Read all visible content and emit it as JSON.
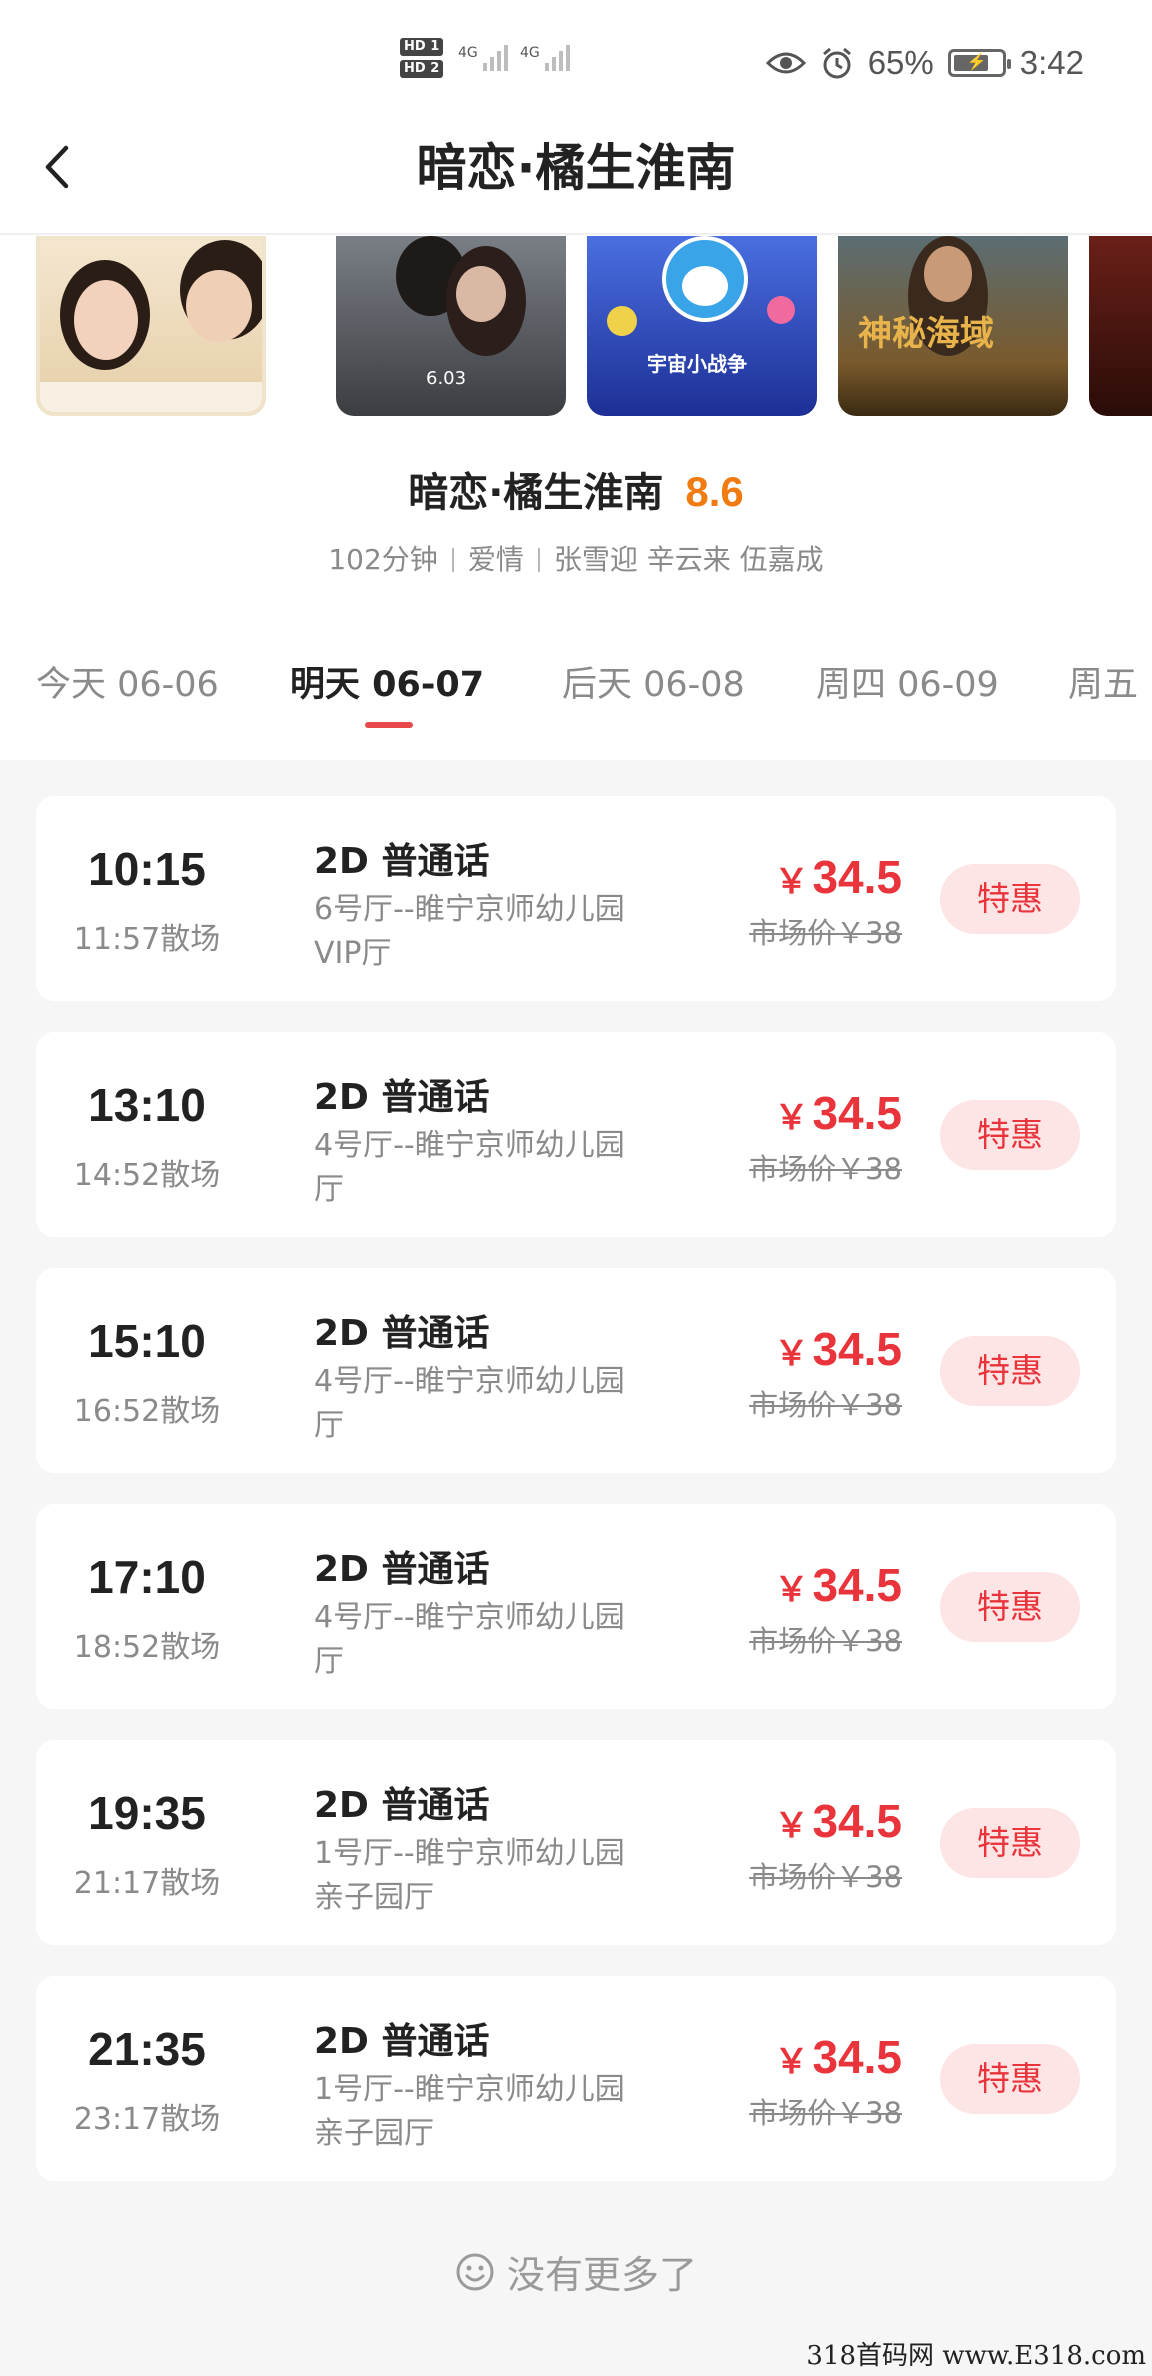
{
  "status_bar": {
    "hd1": "HD 1",
    "hd2": "HD 2",
    "net1": "4G",
    "net2": "4G",
    "battery_percent": "65%",
    "time": "3:42",
    "icons": [
      "eye-icon",
      "alarm-icon",
      "battery-icon"
    ]
  },
  "header": {
    "title": "暗恋·橘生淮南",
    "back_icon": "chevron-left-icon"
  },
  "movie": {
    "title": "暗恋·橘生淮南",
    "score": "8.6",
    "duration": "102分钟",
    "genre": "爱情",
    "cast": "张雪迎 辛云来 伍嘉成"
  },
  "posters": [
    {
      "text": ""
    },
    {
      "text": "6.03"
    },
    {
      "text": "宇宙小战争"
    },
    {
      "text": "神秘海域"
    },
    {
      "text": ""
    }
  ],
  "date_tabs": [
    {
      "label": "今天 06-06"
    },
    {
      "label": "明天 06-07"
    },
    {
      "label": "后天 06-08"
    },
    {
      "label": "周四 06-09"
    },
    {
      "label": "周五"
    }
  ],
  "shows": [
    {
      "start": "10:15",
      "end": "11:57散场",
      "format": "2D 普通话",
      "hall": "6号厅--睢宁京师幼儿园VIP厅",
      "price": "34.5",
      "market": "市场价￥38",
      "badge": "特惠"
    },
    {
      "start": "13:10",
      "end": "14:52散场",
      "format": "2D 普通话",
      "hall": "4号厅--睢宁京师幼儿园厅",
      "price": "34.5",
      "market": "市场价￥38",
      "badge": "特惠"
    },
    {
      "start": "15:10",
      "end": "16:52散场",
      "format": "2D 普通话",
      "hall": "4号厅--睢宁京师幼儿园厅",
      "price": "34.5",
      "market": "市场价￥38",
      "badge": "特惠"
    },
    {
      "start": "17:10",
      "end": "18:52散场",
      "format": "2D 普通话",
      "hall": "4号厅--睢宁京师幼儿园厅",
      "price": "34.5",
      "market": "市场价￥38",
      "badge": "特惠"
    },
    {
      "start": "19:35",
      "end": "21:17散场",
      "format": "2D 普通话",
      "hall": "1号厅--睢宁京师幼儿园亲子园厅",
      "price": "34.5",
      "market": "市场价￥38",
      "badge": "特惠"
    },
    {
      "start": "21:35",
      "end": "23:17散场",
      "format": "2D 普通话",
      "hall": "1号厅--睢宁京师幼儿园亲子园厅",
      "price": "34.5",
      "market": "市场价￥38",
      "badge": "特惠"
    }
  ],
  "price_currency": "￥",
  "footer": {
    "no_more": "没有更多了",
    "icon": "smiley-icon"
  },
  "watermark": "318首码网 www.E318.com",
  "colors": {
    "accent": "#e8343a",
    "score": "#f07b10",
    "badge_bg": "#fde4e5"
  }
}
